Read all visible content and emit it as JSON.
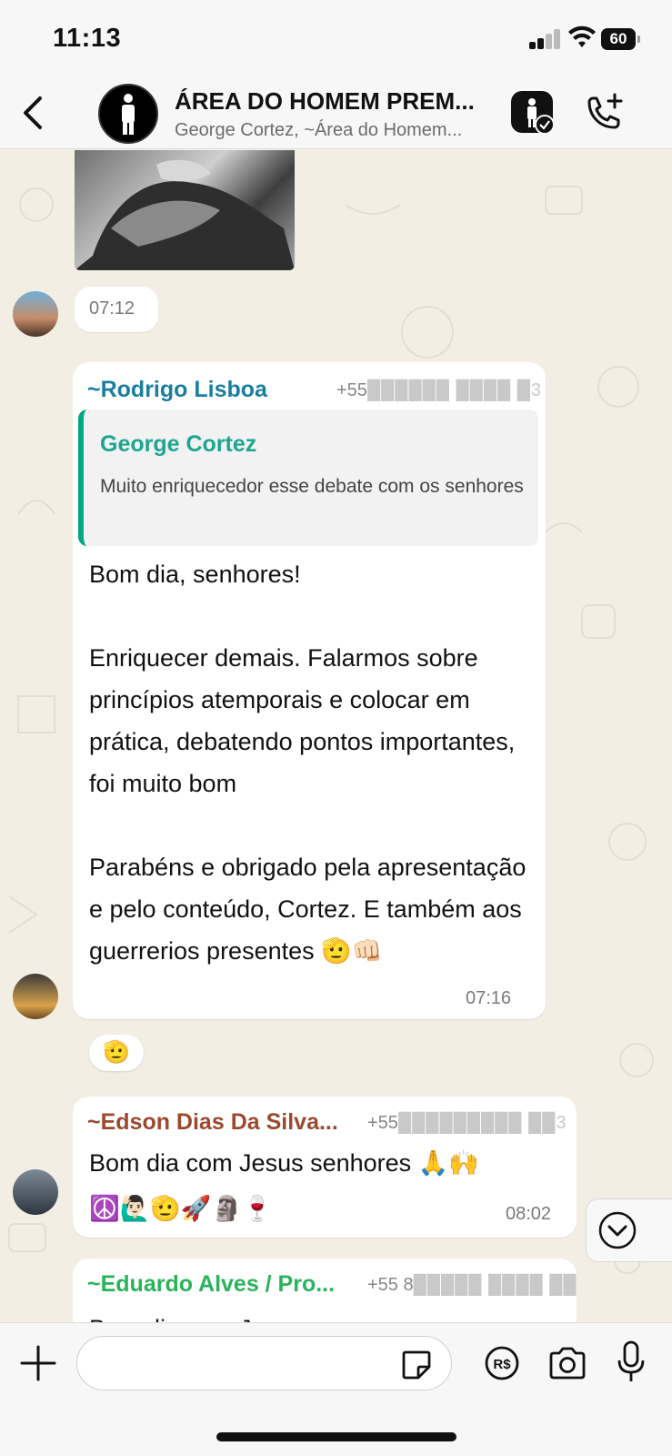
{
  "status_bar": {
    "time": "11:13",
    "battery": "60"
  },
  "header": {
    "title": "ÁREA DO HOMEM PREM...",
    "subtitle": "George Cortez, ~Área do Homem..."
  },
  "messages": {
    "photo_time": "07:12",
    "m1": {
      "sender": "~Rodrigo Lisboa",
      "phone_prefix": "+55",
      "phone_blur": "██████ ████ █3",
      "quote_sender": "George Cortez",
      "quote_text": "Muito enriquecedor esse debate com os senhores",
      "text": "Bom dia, senhores!\n\nEnriquecer demais. Falarmos sobre princípios atemporais e colocar em prática, debatendo pontos importantes, foi muito bom\n\nParabéns e obrigado pela apresentação e pelo conteúdo, Cortez. E também aos guerrerios presentes 🫡👊🏻",
      "time": "07:16",
      "reaction": "🫡"
    },
    "m2": {
      "sender": "~Edson Dias Da Silva...",
      "phone_prefix": "+55",
      "phone_blur": "█████████ ██3",
      "text": "Bom dia com Jesus senhores 🙏🙌\n☮️🙋🏻‍♂️🫡🚀🗿🍷",
      "time": "08:02"
    },
    "m3": {
      "sender": "~Eduardo Alves / Pro...",
      "phone_prefix": "+55 8",
      "phone_blur": "█████ ████ ██",
      "text": "Bom dia com Jesus"
    }
  },
  "composer": {
    "placeholder": ""
  },
  "colors": {
    "rodrigo": "#1a7ea0",
    "edson": "#9b4a2f",
    "eduardo": "#2ab35a",
    "quote_bar": "#00a884"
  },
  "icons": [
    "back-chevron-icon",
    "group-avatar-icon",
    "community-icon",
    "call-add-icon",
    "reaction-icon",
    "chevron-down-icon",
    "plus-icon",
    "sticker-icon",
    "pay-icon",
    "camera-icon",
    "mic-icon"
  ]
}
